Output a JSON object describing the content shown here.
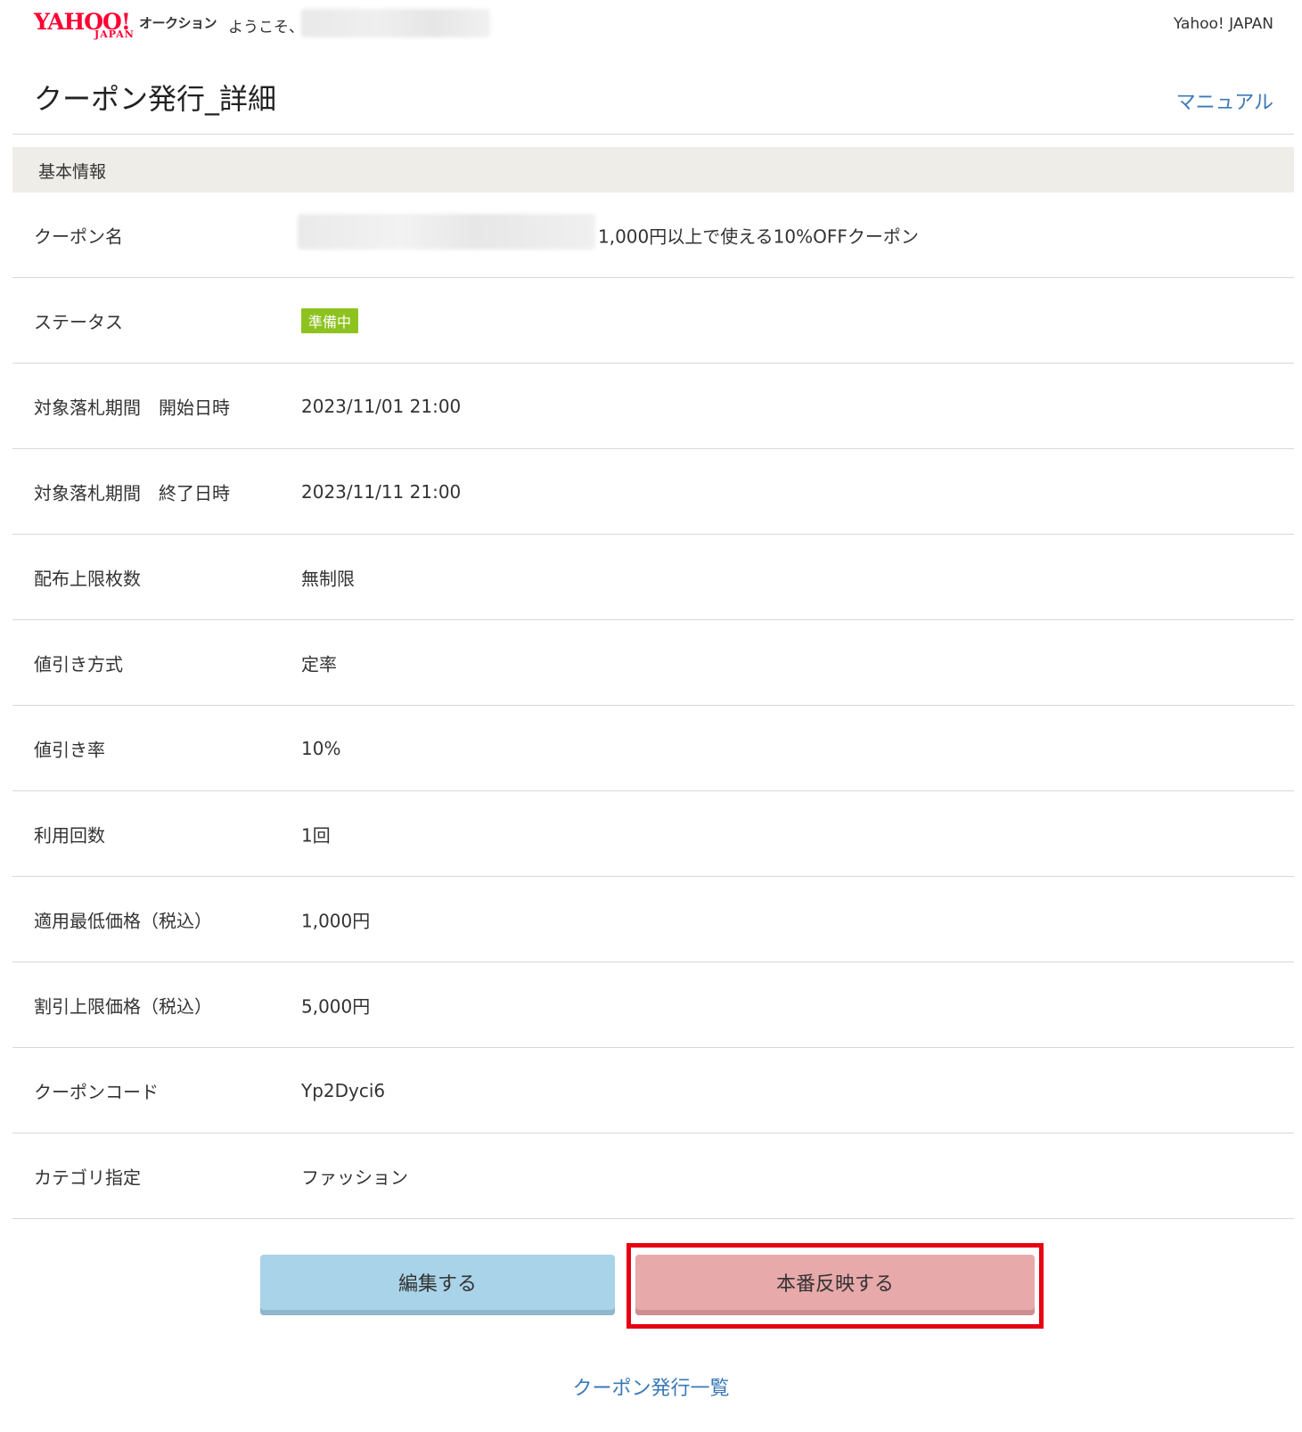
{
  "header": {
    "logo_wordmark": "YAHOO!",
    "logo_sub": "JAPAN",
    "service_name": "オークション",
    "welcome": "ようこそ、",
    "top_link": "Yahoo! JAPAN"
  },
  "page": {
    "title": "クーポン発行_詳細",
    "manual_link": "マニュアル",
    "section_title": "基本情報"
  },
  "details": [
    {
      "label": "クーポン名",
      "value": "1,000円以上で使える10%OFFクーポン"
    },
    {
      "label": "ステータス",
      "value": "準備中"
    },
    {
      "label": "対象落札期間　開始日時",
      "value": "2023/11/01 21:00"
    },
    {
      "label": "対象落札期間　終了日時",
      "value": "2023/11/11 21:00"
    },
    {
      "label": "配布上限枚数",
      "value": "無制限"
    },
    {
      "label": "値引き方式",
      "value": "定率"
    },
    {
      "label": "値引き率",
      "value": "10%"
    },
    {
      "label": "利用回数",
      "value": "1回"
    },
    {
      "label": "適用最低価格（税込）",
      "value": "1,000円"
    },
    {
      "label": "割引上限価格（税込）",
      "value": "5,000円"
    },
    {
      "label": "クーポンコード",
      "value": "Yp2Dyci6"
    },
    {
      "label": "カテゴリ指定",
      "value": "ファッション"
    }
  ],
  "actions": {
    "edit_label": "編集する",
    "publish_label": "本番反映する"
  },
  "footer": {
    "list_link": "クーポン発行一覧"
  },
  "colors": {
    "status_badge": "#8dc21f",
    "link": "#3b79b8",
    "edit_button": "#a9d3e8",
    "publish_button": "#e8a9aa",
    "highlight_box": "#e60012"
  }
}
